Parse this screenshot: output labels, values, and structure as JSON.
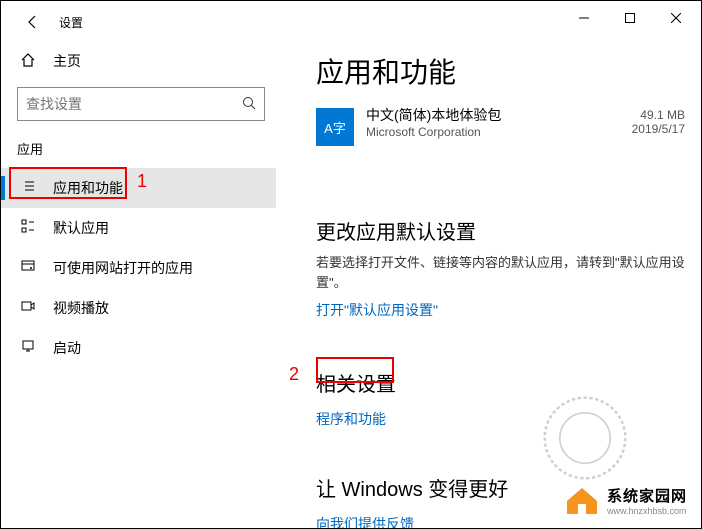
{
  "titlebar": {
    "app_title": "设置"
  },
  "sidebar": {
    "home_label": "主页",
    "search_placeholder": "查找设置",
    "section_label": "应用",
    "items": [
      {
        "label": "应用和功能"
      },
      {
        "label": "默认应用"
      },
      {
        "label": "可使用网站打开的应用"
      },
      {
        "label": "视频播放"
      },
      {
        "label": "启动"
      }
    ]
  },
  "content": {
    "page_title": "应用和功能",
    "app_item": {
      "name": "中文(简体)本地体验包",
      "publisher": "Microsoft Corporation",
      "size": "49.1 MB",
      "date": "2019/5/17",
      "icon_text": "A字"
    },
    "default_apps": {
      "title": "更改应用默认设置",
      "desc": "若要选择打开文件、链接等内容的默认应用，请转到\"默认应用设置\"。",
      "link": "打开\"默认应用设置\""
    },
    "related": {
      "title": "相关设置",
      "link": "程序和功能"
    },
    "feedback": {
      "title": "让 Windows 变得更好",
      "link": "向我们提供反馈"
    }
  },
  "annotations": {
    "one": "1",
    "two": "2"
  },
  "watermark": {
    "cn": "系统家园网",
    "en": "www.hnzxhbsb.com"
  }
}
